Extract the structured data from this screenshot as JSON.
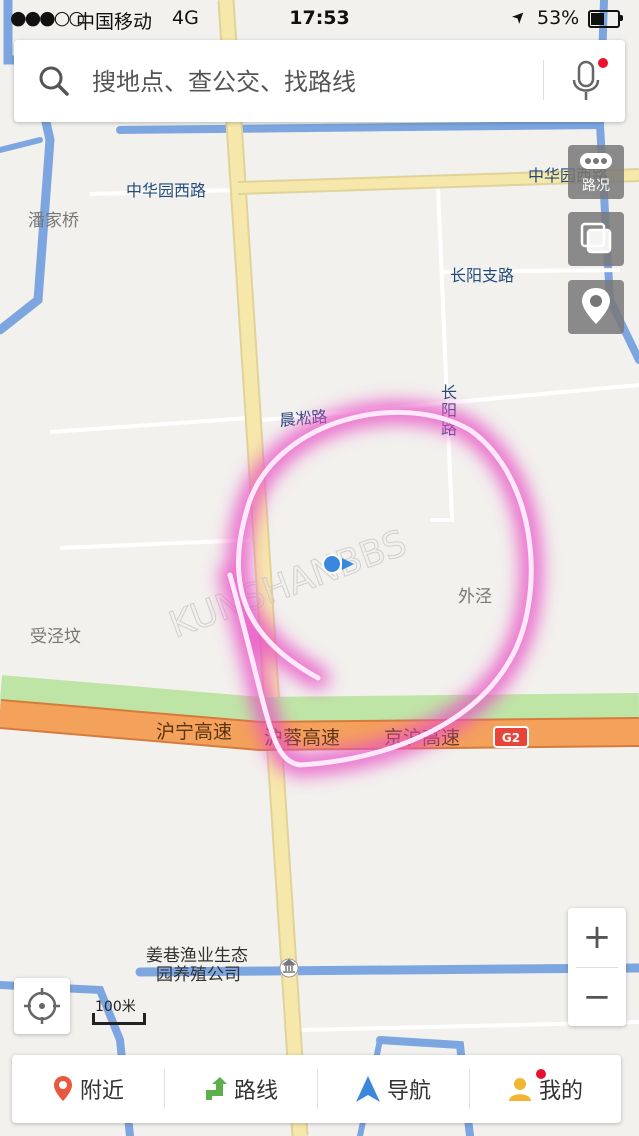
{
  "status_bar": {
    "signal": "●●●○○",
    "carrier": "中国移动",
    "network": "4G",
    "time": "17:53",
    "location_arrow": "➤",
    "battery_percent_text": "53%",
    "battery_level": 0.53
  },
  "search": {
    "placeholder": "搜地点、查公交、找路线",
    "icon": "search-icon",
    "voice_icon": "microphone-icon"
  },
  "map": {
    "roads": {
      "zhonghua_west": "中华园西路",
      "zhonghua_east": "中华园西路",
      "changyang_branch": "长阳支路",
      "changyang_vertical": [
        "长",
        "阳",
        "路"
      ],
      "chenxing": "晨凇路",
      "hurong": "沪宁高速",
      "hurong2": "沪蓉高速",
      "jinghu": "京沪高速",
      "g2_shield": "G2"
    },
    "places": {
      "panjiaqiao": "潘家桥",
      "shoujingba": "受泾坟",
      "waijing": "外泾",
      "jiangxiang_1": "姜巷渔业生态",
      "jiangxiang_2": "园养殖公司"
    },
    "watermark": "KUNSHANBBS",
    "colors": {
      "background": "#f2f1ee",
      "water": "#7da6e0",
      "main_road": "#f6e8ab",
      "highway": "#f4a15c",
      "green": "#bfe5a6",
      "annotation": "#e94fc4",
      "location_dot": "#3a87dd"
    }
  },
  "controls": {
    "traffic_label": "路况",
    "traffic_icon": "traffic-icon",
    "layers_icon": "layers-icon",
    "pin_icon": "location-pin-icon",
    "zoom_in": "+",
    "zoom_out": "−",
    "locate_icon": "crosshair-icon",
    "scale": "100米"
  },
  "bottom_nav": [
    {
      "label": "附近",
      "icon": "nearby-pin-icon"
    },
    {
      "label": "路线",
      "icon": "route-arrow-icon"
    },
    {
      "label": "导航",
      "icon": "navigation-arrow-icon"
    },
    {
      "label": "我的",
      "icon": "user-icon"
    }
  ]
}
